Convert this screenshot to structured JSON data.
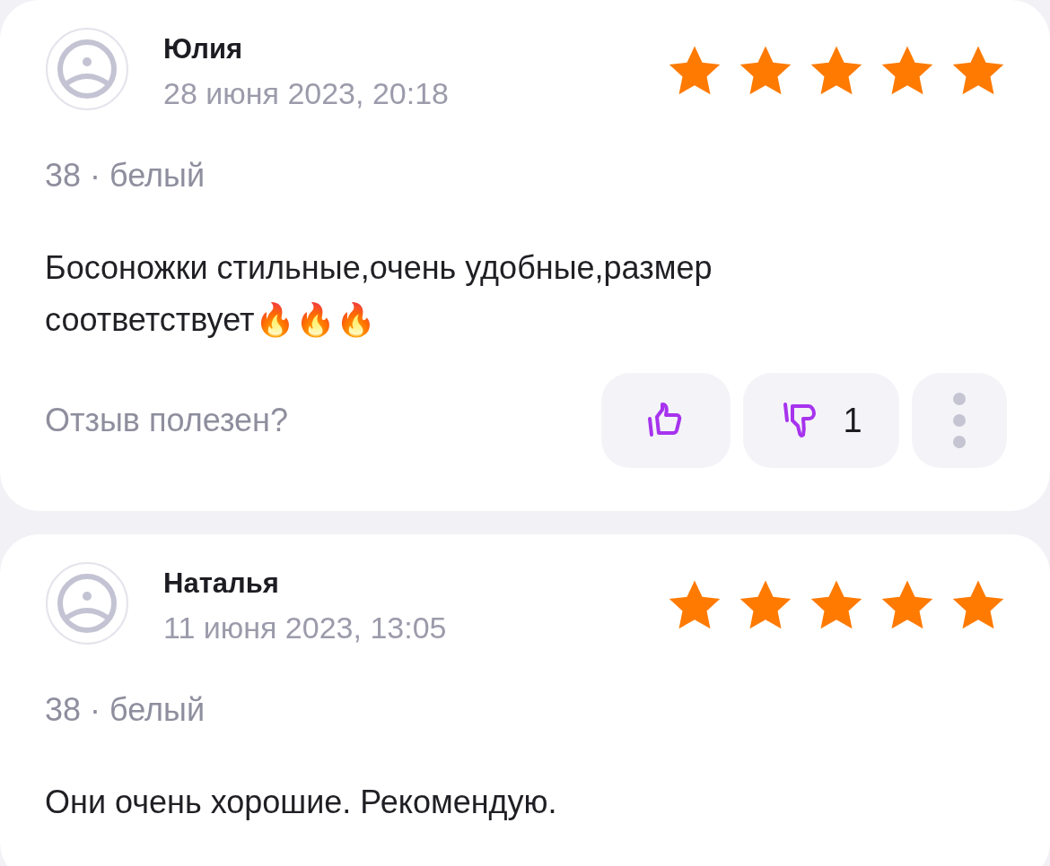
{
  "reviews": [
    {
      "author": "Юлия",
      "date": "28 июня 2023, 20:18",
      "stars": 5,
      "variant": "38 · белый",
      "text": "Босоножки стильные,очень удобные,размер соответствует🔥🔥🔥",
      "feedback": {
        "question": "Отзыв полезен?",
        "dislikes": "1"
      }
    },
    {
      "author": "Наталья",
      "date": "11 июня 2023, 13:05",
      "stars": 5,
      "variant": "38 · белый",
      "text": "Они очень хорошие. Рекомендую."
    }
  ]
}
